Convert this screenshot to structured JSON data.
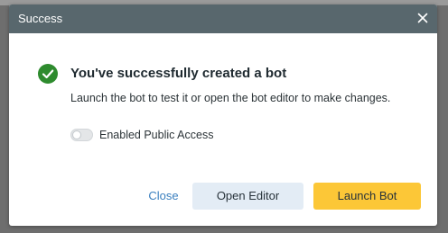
{
  "dialog": {
    "title": "Success",
    "heading": "You've successfully created a bot",
    "message": "Launch the bot to test it or open the bot editor to make changes.",
    "public_access": {
      "label": "Enabled Public Access",
      "enabled": false
    },
    "buttons": {
      "close": "Close",
      "open_editor": "Open Editor",
      "launch": "Launch Bot"
    }
  },
  "colors": {
    "header": "#58676d",
    "success": "#2e8b2e",
    "link": "#3a7fbf",
    "primary": "#fcc737",
    "secondary": "#e3ecf5"
  },
  "icons": {
    "close": "close-icon",
    "success": "check-circle-icon"
  }
}
